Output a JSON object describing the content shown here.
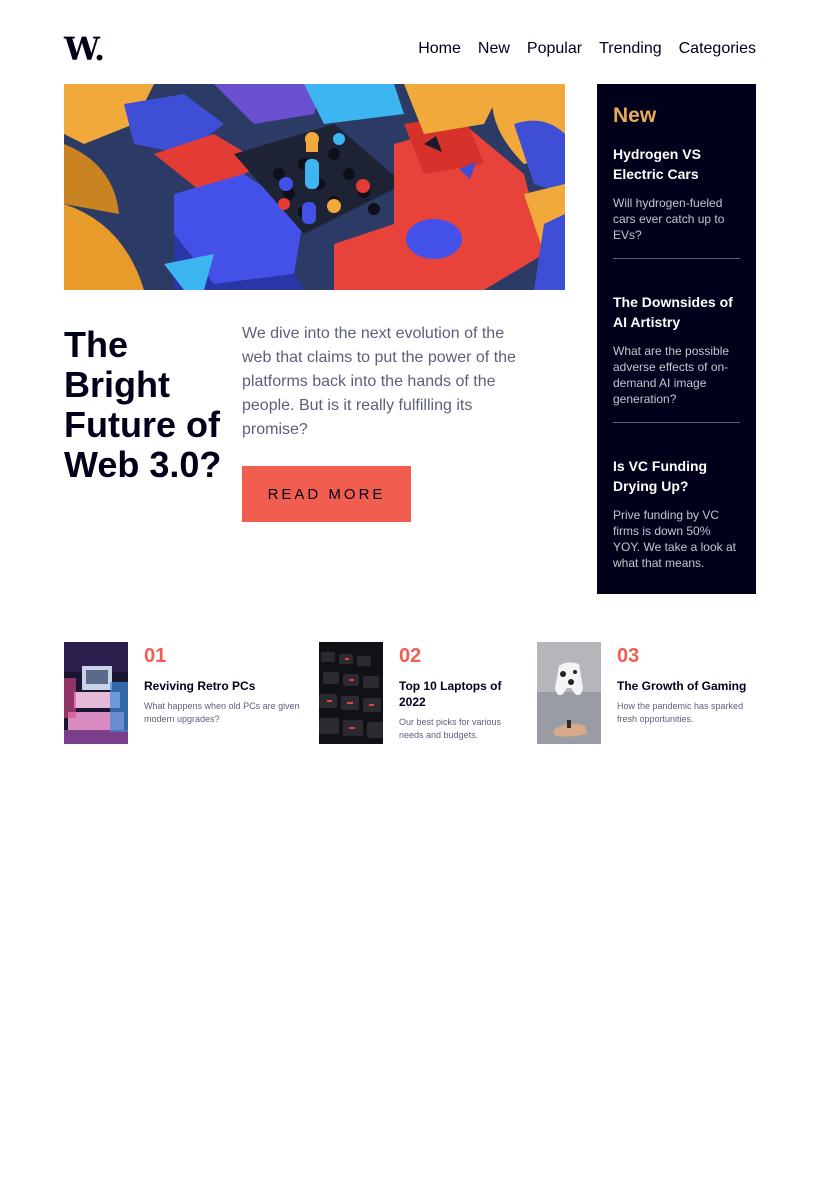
{
  "header": {
    "logo": "W.",
    "nav": [
      "Home",
      "New",
      "Popular",
      "Trending",
      "Categories"
    ]
  },
  "hero": {
    "image_alt": "colorful abstract 3D blocks",
    "title": "The Bright Future of Web 3.0?",
    "text": "We dive into the next evolution of the web that claims to put the power of the platforms back into the hands of the people. But is it really fulfilling its promise?",
    "button": "READ MORE"
  },
  "new_panel": {
    "heading": "New",
    "items": [
      {
        "title": "Hydrogen VS Electric Cars",
        "text": "Will hydrogen-fueled cars ever catch up to EVs?"
      },
      {
        "title": "The Downsides of AI Artistry",
        "text": "What are the possible adverse effects of on-demand AI image generation?"
      },
      {
        "title": "Is VC Funding Drying Up?",
        "text": "Prive funding by VC firms is down 50% YOY. We take a look at what that means."
      }
    ]
  },
  "articles": [
    {
      "num": "01",
      "title": "Reviving Retro PCs",
      "text": "What happens when old PCs are given modern upgrades?"
    },
    {
      "num": "02",
      "title": "Top 10 Laptops of 2022",
      "text": "Our best picks for various needs and budgets."
    },
    {
      "num": "03",
      "title": "The Growth of Gaming",
      "text": "How the pandemic has sparked fresh opportunities."
    }
  ],
  "colors": {
    "soft_red": "#f15e50",
    "soft_orange": "#e9ab53",
    "very_dark_blue": "#00001a",
    "grayish_blue": "#5d5f79",
    "off_white": "#fffdfa"
  }
}
